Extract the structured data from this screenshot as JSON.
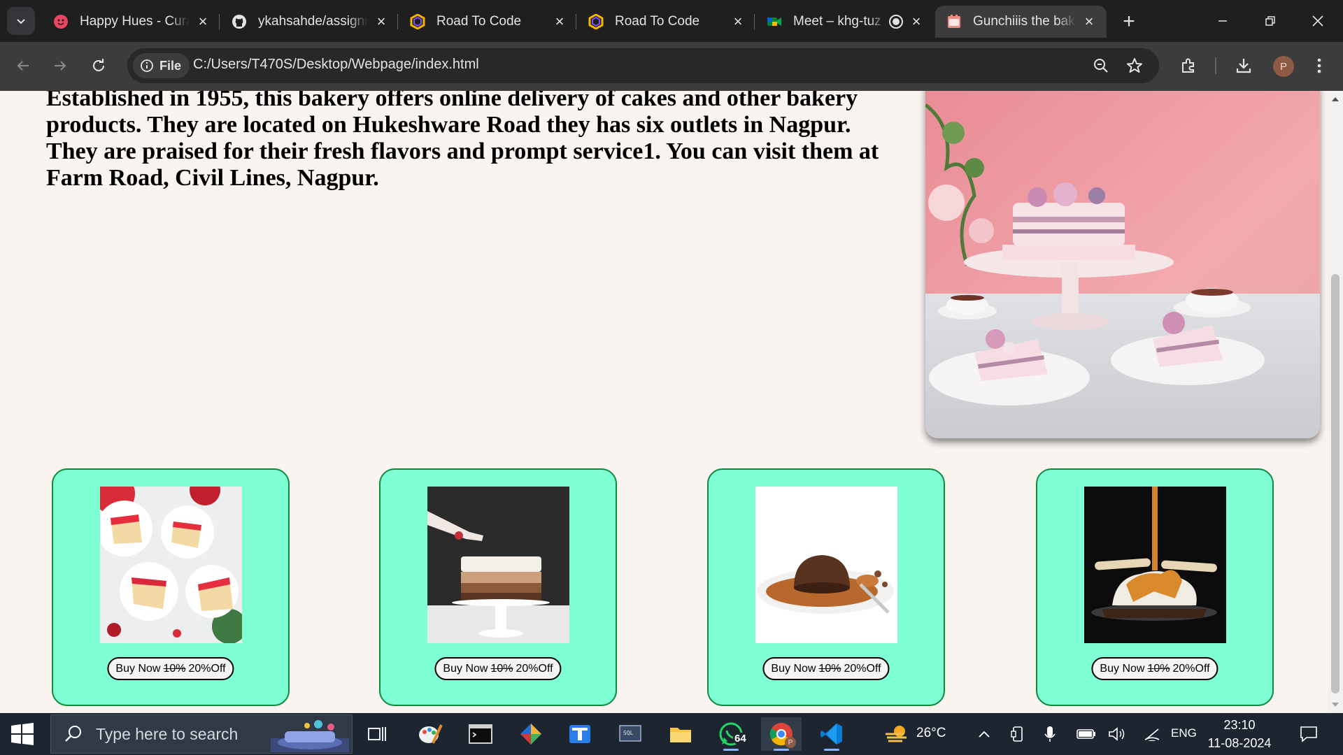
{
  "browser": {
    "tabs": [
      {
        "title": "Happy Hues - Cura",
        "icon": "happy-hues-icon",
        "active": false
      },
      {
        "title": "ykahsahde/assignm",
        "icon": "github-icon",
        "active": false
      },
      {
        "title": "Road To Code",
        "icon": "road-to-code-icon",
        "active": false
      },
      {
        "title": "Road To Code",
        "icon": "road-to-code-icon",
        "active": false
      },
      {
        "title": "Meet – khg-tuz",
        "icon": "google-meet-icon",
        "active": false
      },
      {
        "title": "Gunchiiis the baker",
        "icon": "bakery-page-icon",
        "active": true
      }
    ],
    "site_chip": "File",
    "url": "C:/Users/T470S/Desktop/Webpage/index.html",
    "profile_initial": "P"
  },
  "page": {
    "about_text": "Established in 1955, this bakery offers online delivery of cakes and other bakery products. They are located on Hukeshware Road they has six outlets in Nagpur. They are praised for their fresh flavors and prompt service1. You can visit them at Farm Road, Civil Lines, Nagpur.",
    "hero_image": "layered pink cake on cake stand with tea cups",
    "cards": [
      {
        "image": "strawberry cream cake slices",
        "buy_label": "Buy Now",
        "old_discount": "10%",
        "new_discount": "20%Off"
      },
      {
        "image": "piped chocolate layer cake on stand",
        "buy_label": "Buy Now",
        "old_discount": "10%",
        "new_discount": "20%Off"
      },
      {
        "image": "chocolate lava cake with caramel",
        "buy_label": "Buy Now",
        "old_discount": "10%",
        "new_discount": "20%Off"
      },
      {
        "image": "ice cream dessert with caramel drizzle",
        "buy_label": "Buy Now",
        "old_discount": "10%",
        "new_discount": "20%Off"
      }
    ]
  },
  "taskbar": {
    "search_placeholder": "Type here to search",
    "whatsapp_badge": "64",
    "weather": "26°C",
    "language": "ENG",
    "time": "23:10",
    "date": "11-08-2024"
  },
  "colors": {
    "card_bg": "#7fffd4",
    "card_border": "#0f8a3c",
    "page_bg": "#faf4f1",
    "browser_dark": "#1f1f1f"
  }
}
